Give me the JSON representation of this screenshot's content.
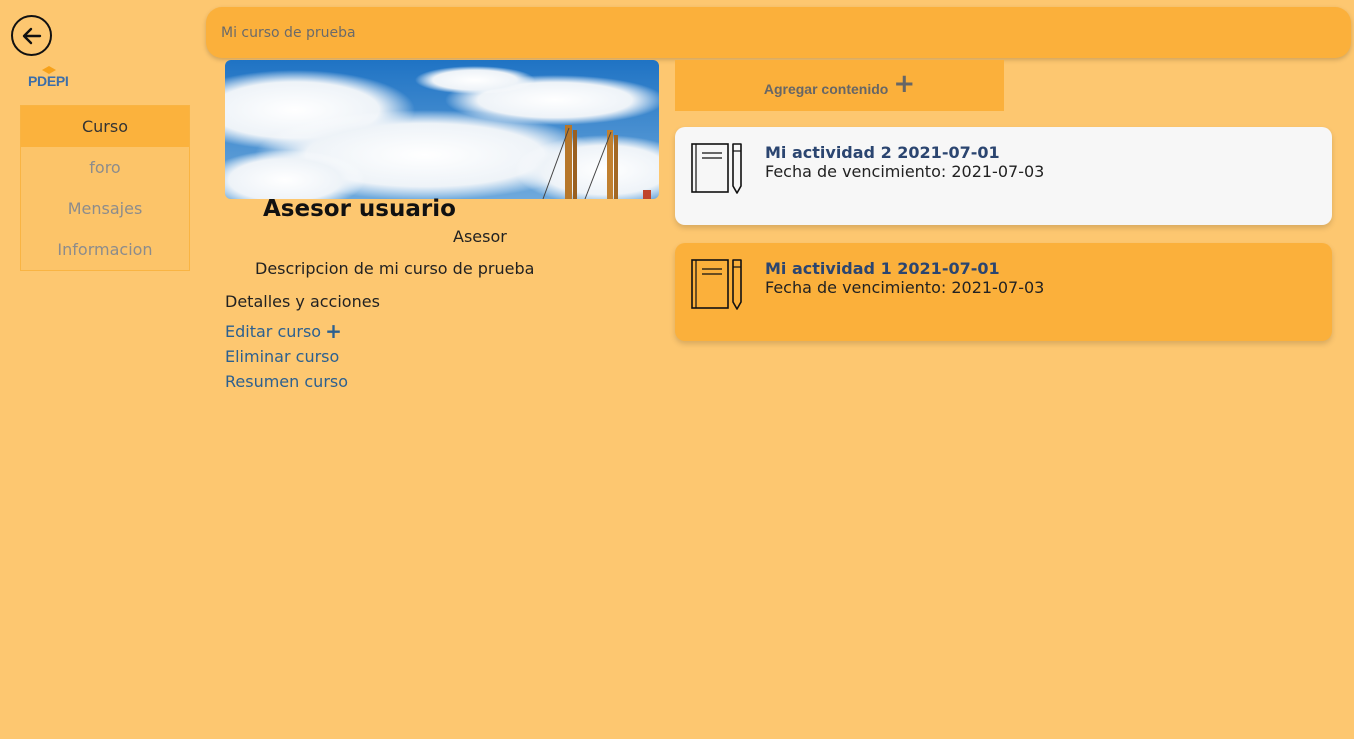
{
  "nav": {
    "back_icon": "arrow-left-circle-icon",
    "logo_text": "PDEPI"
  },
  "sidebar": {
    "items": [
      {
        "label": "Curso",
        "active": true
      },
      {
        "label": "foro",
        "active": false
      },
      {
        "label": "Mensajes",
        "active": false
      },
      {
        "label": "Informacion",
        "active": false
      }
    ]
  },
  "header": {
    "title": "Mi curso de prueba"
  },
  "course": {
    "owner_name": "Asesor usuario",
    "owner_role": "Asesor",
    "description": "Descripcion de mi curso de prueba",
    "details_heading": "Detalles y acciones",
    "actions": {
      "edit": "Editar curso",
      "delete": "Eliminar curso",
      "summary": "Resumen curso"
    }
  },
  "content": {
    "add_label": "Agregar contenido",
    "add_icon": "plus-icon",
    "activities": [
      {
        "title": "Mi actividad 2 2021-07-01",
        "due": "Fecha de vencimiento: 2021-07-03",
        "icon": "notebook-pencil-icon"
      },
      {
        "title": "Mi actividad 1 2021-07-01",
        "due": "Fecha de vencimiento: 2021-07-03",
        "icon": "notebook-pencil-icon"
      }
    ]
  },
  "colors": {
    "background": "#fdc770",
    "accent": "#fbb03b",
    "link": "#2c6090",
    "activity_title": "#2b4570"
  }
}
